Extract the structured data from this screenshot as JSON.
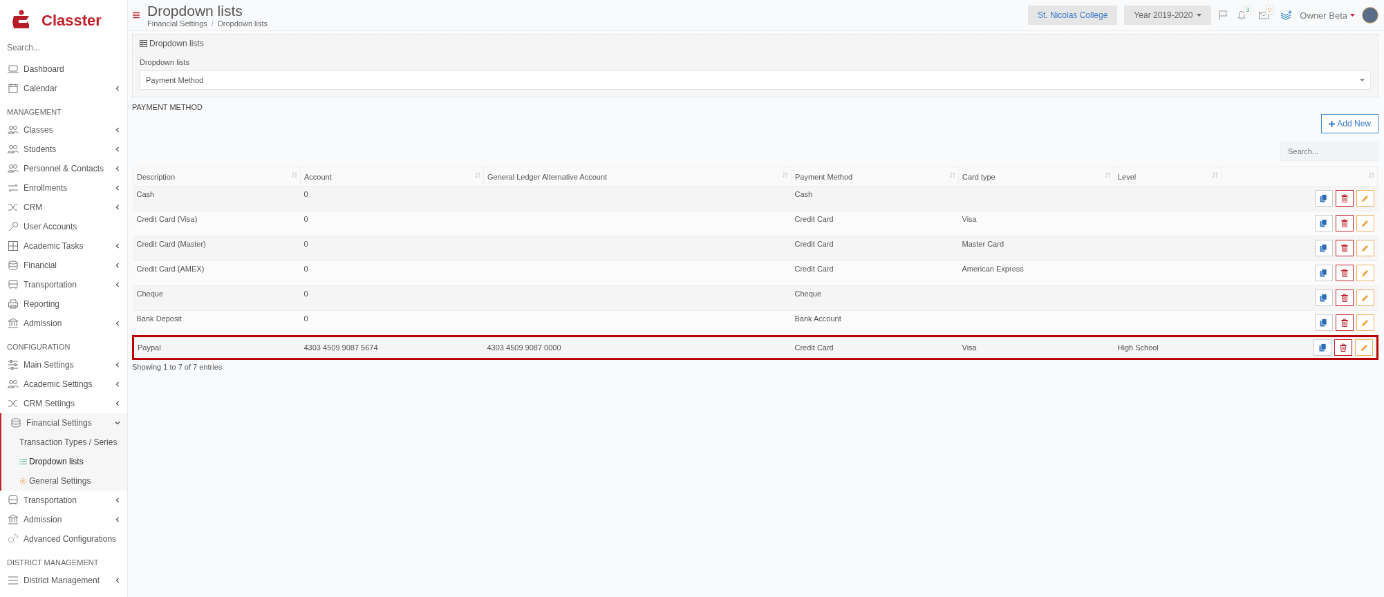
{
  "brand": {
    "name": "Classter"
  },
  "sidebar": {
    "search": {
      "placeholder": "Search..."
    },
    "sections": [
      {
        "items": [
          {
            "label": "Dashboard",
            "kind": "link"
          },
          {
            "label": "Calendar",
            "kind": "menu",
            "expanded": false
          }
        ]
      },
      {
        "title": "MANAGEMENT",
        "items": [
          {
            "label": "Classes",
            "kind": "menu",
            "expanded": false
          },
          {
            "label": "Students",
            "kind": "menu",
            "expanded": false
          },
          {
            "label": "Personnel & Contacts",
            "kind": "menu",
            "expanded": false
          },
          {
            "label": "Enrollments",
            "kind": "menu",
            "expanded": false
          },
          {
            "label": "CRM",
            "kind": "menu",
            "expanded": false
          },
          {
            "label": "User Accounts",
            "kind": "link"
          },
          {
            "label": "Academic Tasks",
            "kind": "menu",
            "expanded": false
          },
          {
            "label": "Financial",
            "kind": "menu",
            "expanded": false
          },
          {
            "label": "Transportation",
            "kind": "menu",
            "expanded": false
          },
          {
            "label": "Reporting",
            "kind": "link"
          },
          {
            "label": "Admission",
            "kind": "menu",
            "expanded": false
          }
        ]
      },
      {
        "title": "CONFIGURATION",
        "items": [
          {
            "label": "Main Settings",
            "kind": "menu",
            "expanded": false
          },
          {
            "label": "Academic Settings",
            "kind": "menu",
            "expanded": false
          },
          {
            "label": "CRM Settings",
            "kind": "menu",
            "expanded": false
          },
          {
            "label": "Financial Settings",
            "kind": "menu",
            "expanded": true,
            "children": [
              {
                "label": "Transaction Types / Series",
                "selected": false
              },
              {
                "label": "Dropdown lists",
                "selected": true
              },
              {
                "label": "General Settings",
                "selected": false
              }
            ]
          },
          {
            "label": "Transportation",
            "kind": "menu",
            "expanded": false
          },
          {
            "label": "Admission",
            "kind": "menu",
            "expanded": false
          },
          {
            "label": "Advanced Configurations",
            "kind": "link"
          }
        ]
      },
      {
        "title": "DISTRICT MANAGEMENT",
        "items": [
          {
            "label": "District Management",
            "kind": "menu",
            "expanded": false
          }
        ]
      }
    ]
  },
  "header": {
    "title": "Dropdown lists",
    "breadcrumb": [
      "Financial Settings",
      "Dropdown lists"
    ],
    "breadcrumb_separator": "/",
    "school": "St. Nicolas College",
    "year": "Year 2019-2020",
    "notifications": "3",
    "messages": "0",
    "user": "Owner Beta"
  },
  "panel": {
    "legend": "Dropdown lists",
    "field_label": "Dropdown lists",
    "field_value": "Payment Method"
  },
  "section_title": "PAYMENT METHOD",
  "add_button": "Add New",
  "table_search": {
    "placeholder": "Search..."
  },
  "table": {
    "columns": [
      "Description",
      "Account",
      "General Ledger Alternative Account",
      "Payment Method",
      "Card type",
      "Level"
    ],
    "rows": [
      {
        "cells": [
          "Cash",
          "0",
          "",
          "Cash",
          "",
          ""
        ],
        "highlighted": false
      },
      {
        "cells": [
          "Credit Card (Visa)",
          "0",
          "",
          "Credit Card",
          "Visa",
          ""
        ],
        "highlighted": false
      },
      {
        "cells": [
          "Credit Card (Master)",
          "0",
          "",
          "Credit Card",
          "Master Card",
          ""
        ],
        "highlighted": false
      },
      {
        "cells": [
          "Credit Card (AMEX)",
          "0",
          "",
          "Credit Card",
          "American Express",
          ""
        ],
        "highlighted": false
      },
      {
        "cells": [
          "Cheque",
          "0",
          "",
          "Cheque",
          "",
          ""
        ],
        "highlighted": false
      },
      {
        "cells": [
          "Bank Deposit",
          "0",
          "",
          "Bank Account",
          "",
          ""
        ],
        "highlighted": false
      },
      {
        "cells": [
          "Paypal",
          "4303 4509 9087 5674",
          "4303 4509 9087 0000",
          "Credit Card",
          "Visa",
          "High School"
        ],
        "highlighted": true
      }
    ]
  },
  "footer": "Showing 1 to 7 of 7 entries"
}
